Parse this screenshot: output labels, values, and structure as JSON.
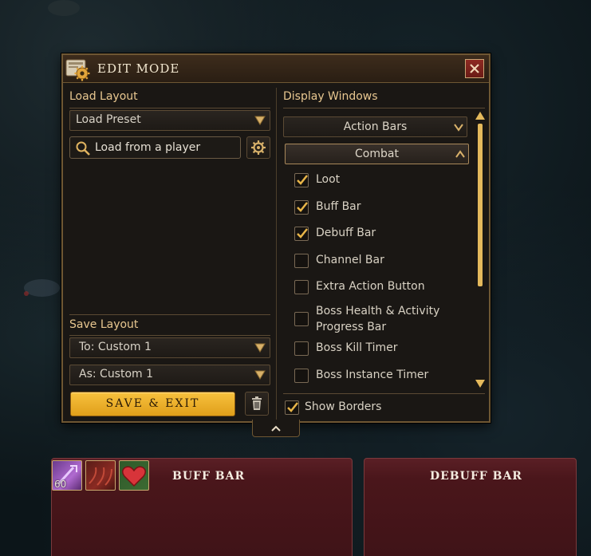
{
  "window": {
    "title": "EDIT MODE",
    "icons": {
      "title": "gear-document-icon",
      "close": "close-icon"
    }
  },
  "load_layout": {
    "label": "Load Layout",
    "preset_value": "Load Preset",
    "search_placeholder": "Load from a player"
  },
  "save_layout": {
    "label": "Save Layout",
    "to_value": "To: Custom 1",
    "as_value": "As: Custom 1",
    "save_exit_label": "SAVE & EXIT"
  },
  "display_windows": {
    "label": "Display Windows",
    "category_dropdown": "Action Bars",
    "subcategory_dropdown": "Combat",
    "items": [
      {
        "label": "Loot",
        "checked": true
      },
      {
        "label": "Buff Bar",
        "checked": true
      },
      {
        "label": "Debuff Bar",
        "checked": true
      },
      {
        "label": "Channel Bar",
        "checked": false
      },
      {
        "label": "Extra Action Button",
        "checked": false
      },
      {
        "label": "Boss Health & Activity Progress Bar",
        "checked": false
      },
      {
        "label": "Boss Kill Timer",
        "checked": false
      },
      {
        "label": "Boss Instance Timer",
        "checked": false
      }
    ],
    "show_borders": {
      "label": "Show Borders",
      "checked": true
    }
  },
  "bars": {
    "buff_bar_title": "BUFF BAR",
    "debuff_bar_title": "DEBUFF BAR",
    "buff_icons": [
      {
        "icon": "purple-arrow-icon",
        "count": "60"
      },
      {
        "icon": "red-wisps-icon",
        "count": ""
      },
      {
        "icon": "red-heart-icon",
        "count": ""
      }
    ]
  },
  "colors": {
    "accent_gold": "#e8c790",
    "button_gold": "#f2b42c",
    "panel_red": "#4a161b"
  }
}
